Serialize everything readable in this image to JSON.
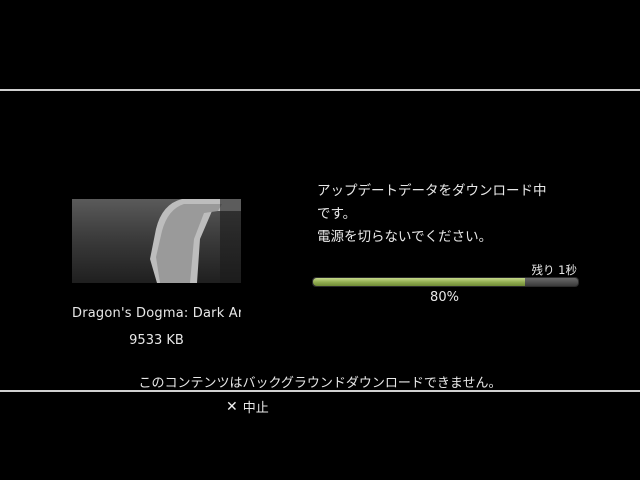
{
  "game": {
    "title": "Dragon's Dogma: Dark Arisen",
    "size": "9533 KB"
  },
  "status": {
    "line1": "アップデートデータをダウンロード中",
    "line2": "です。",
    "line3": "電源を切らないでください。",
    "remaining_label": "残り 1秒"
  },
  "progress": {
    "percent_text": "80%",
    "value": 0.8,
    "fill_color": "#93ad52"
  },
  "notice": "このコンテンツはバックグラウンドダウンロードできません。",
  "cancel": {
    "icon": "cross-icon",
    "label": "中止"
  }
}
